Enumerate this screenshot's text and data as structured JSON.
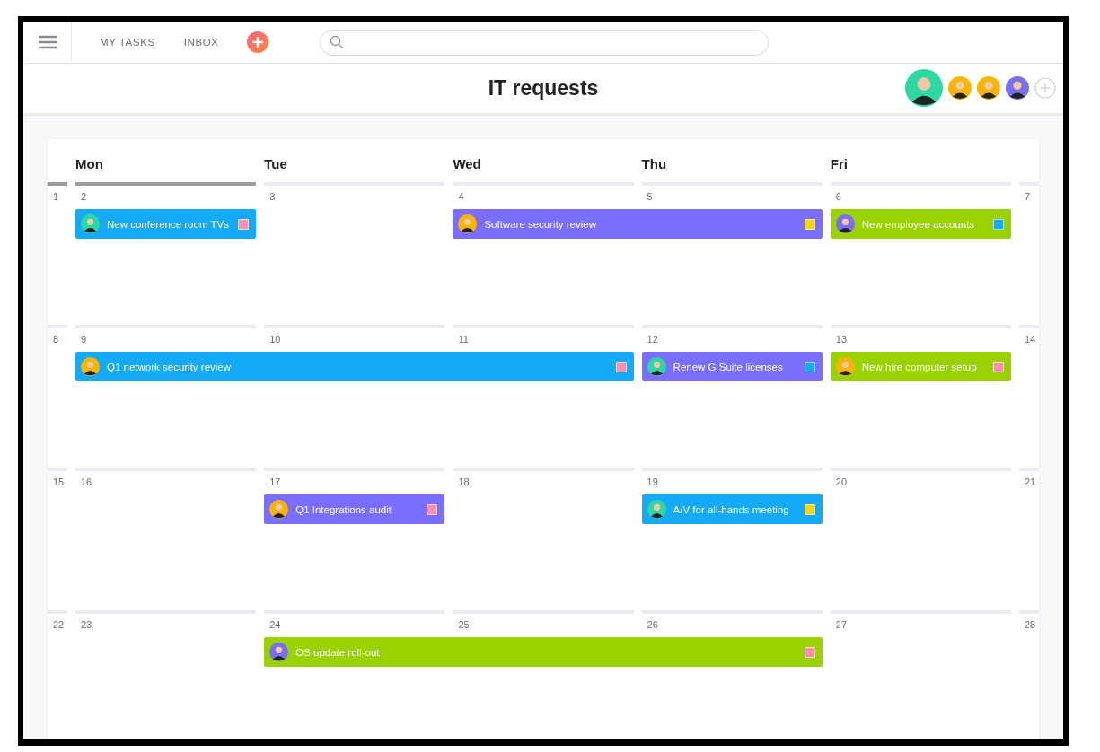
{
  "top_bar": {
    "nav": [
      {
        "label": "MY TASKS"
      },
      {
        "label": "INBOX"
      }
    ]
  },
  "project": {
    "title": "IT requests",
    "members": [
      {
        "color": "#2ed8a3",
        "current_user": true
      },
      {
        "color": "#fcb400",
        "current_user": false
      },
      {
        "color": "#fcb400",
        "current_user": false
      },
      {
        "color": "#7a6ff0",
        "current_user": false
      }
    ]
  },
  "calendar": {
    "day_names": [
      "Mon",
      "Tue",
      "Wed",
      "Thu",
      "Fri"
    ],
    "weeks": [
      {
        "days": [
          {
            "number": "1",
            "today": true
          },
          {
            "number": "2",
            "today": true,
            "task": {
              "title": "New conference room TVs",
              "color": "#14aaf5",
              "tag": {
                "color": "#fc91ad"
              },
              "assignee": {
                "color": "#2ed8a3"
              }
            }
          },
          {
            "number": "3",
            "today": false
          },
          {
            "number": "4",
            "today": false,
            "task": {
              "title": "Software security review",
              "color": "#796eff",
              "tag": {
                "color": "#fcd600"
              },
              "assignee": {
                "color": "#fcb400"
              }
            }
          },
          {
            "number": "5",
            "today": false,
            "continues": true
          },
          {
            "number": "6",
            "today": false,
            "task": {
              "title": "New employee accounts",
              "color": "#9ad100",
              "tag": {
                "color": "#14aaf5"
              },
              "assignee": {
                "color": "#7a6ff0"
              }
            }
          },
          {
            "number": "7",
            "today": false
          }
        ]
      },
      {
        "days": [
          {
            "number": "8",
            "today": false
          },
          {
            "number": "9",
            "today": false,
            "task": {
              "title": "Q1 network security review",
              "color": "#14aaf5",
              "tag": {
                "color": "#fc91ad"
              },
              "assignee": {
                "color": "#fcb400"
              }
            }
          },
          {
            "number": "10",
            "today": false,
            "continues": true
          },
          {
            "number": "11",
            "today": false,
            "continues": true
          },
          {
            "number": "12",
            "today": false,
            "task": {
              "title": "Renew G Suite licenses",
              "color": "#796eff",
              "tag": {
                "color": "#14aaf5"
              },
              "assignee": {
                "color": "#2ed8a3"
              }
            }
          },
          {
            "number": "13",
            "today": false,
            "task": {
              "title": "New hire computer setup",
              "color": "#9ad100",
              "tag": {
                "color": "#fc91ad"
              },
              "assignee": {
                "color": "#fcb400"
              }
            }
          },
          {
            "number": "14",
            "today": false
          }
        ]
      },
      {
        "days": [
          {
            "number": "15",
            "today": false
          },
          {
            "number": "16",
            "today": false
          },
          {
            "number": "17",
            "today": false,
            "task": {
              "title": "Q1 Integrations audit",
              "color": "#796eff",
              "tag": {
                "color": "#fc91ad"
              },
              "assignee": {
                "color": "#fcb400"
              }
            }
          },
          {
            "number": "18",
            "today": false
          },
          {
            "number": "19",
            "today": false,
            "task": {
              "title": "A/V for all-hands meeting",
              "color": "#14aaf5",
              "tag": {
                "color": "#fcd600"
              },
              "assignee": {
                "color": "#2ed8a3"
              }
            }
          },
          {
            "number": "20",
            "today": false
          },
          {
            "number": "21",
            "today": false
          }
        ]
      },
      {
        "days": [
          {
            "number": "22",
            "today": false
          },
          {
            "number": "23",
            "today": false
          },
          {
            "number": "24",
            "today": false,
            "task": {
              "title": "OS update roll-out",
              "color": "#9ad100",
              "tag": {
                "color": "#fc91ad"
              },
              "assignee": {
                "color": "#7a6ff0"
              }
            }
          },
          {
            "number": "25",
            "today": false,
            "continues": true
          },
          {
            "number": "26",
            "today": false,
            "continues": true
          },
          {
            "number": "27",
            "today": false
          },
          {
            "number": "28",
            "today": false
          }
        ]
      }
    ]
  }
}
